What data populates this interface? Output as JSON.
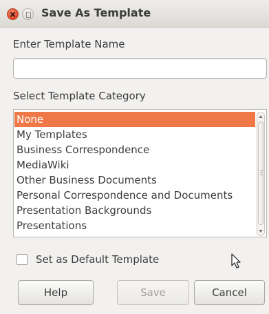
{
  "window": {
    "title": "Save As Template"
  },
  "form": {
    "name_label": "Enter Template Name",
    "name_value": "",
    "category_label": "Select Template Category",
    "categories": [
      "None",
      "My Templates",
      "Business Correspondence",
      "MediaWiki",
      "Other Business Documents",
      "Personal Correspondence and Documents",
      "Presentation Backgrounds",
      "Presentations"
    ],
    "selected_category": "None",
    "default_checkbox_label": "Set as Default Template",
    "default_checked": false
  },
  "buttons": {
    "help": "Help",
    "save": "Save",
    "cancel": "Cancel"
  },
  "colors": {
    "selection": "#f07746",
    "close_button": "#df4a2a"
  }
}
